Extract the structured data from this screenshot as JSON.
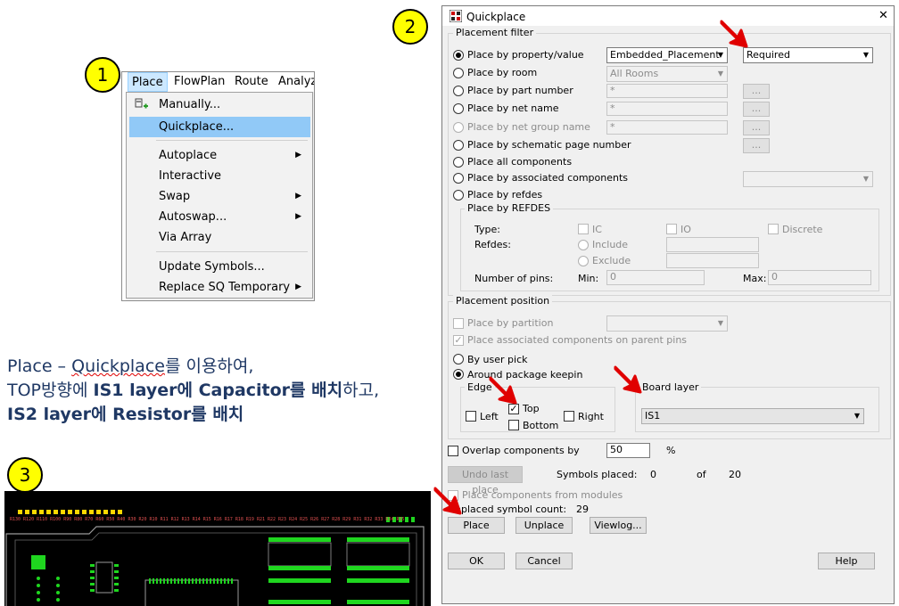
{
  "badges": [
    "1",
    "2",
    "3"
  ],
  "menu": {
    "menubar": [
      "Place",
      "FlowPlan",
      "Route",
      "Analyze"
    ],
    "items": [
      {
        "label": "Manually...",
        "arrow": false
      },
      {
        "label": "Quickplace...",
        "arrow": false
      },
      {
        "label": "Autoplace",
        "arrow": true
      },
      {
        "label": "Interactive",
        "arrow": false
      },
      {
        "label": "Swap",
        "arrow": true
      },
      {
        "label": "Autoswap...",
        "arrow": true
      },
      {
        "label": "Via Array",
        "arrow": false
      },
      {
        "label": "Update Symbols...",
        "arrow": false
      },
      {
        "label": "Replace SQ Temporary",
        "arrow": true
      }
    ],
    "arrow_glyph": "▶"
  },
  "instruction": {
    "line1_a": "Place  – ",
    "line1_b": "Quickplace",
    "line1_c": "를  이용하여,",
    "line2_a": "TOP방향에 ",
    "line2_b": "IS1 layer에 Capacitor를 배치",
    "line2_c": "하고,",
    "line3": "IS2 layer에 Resistor를  배치"
  },
  "dialog": {
    "title": "Quickplace",
    "close": "✕",
    "filter_group": "Placement filter",
    "filter_options": [
      "Place by property/value",
      "Place by room",
      "Place by part number",
      "Place by net name",
      "Place by net group name",
      "Place by schematic page number",
      "Place all components",
      "Place by associated components",
      "Place by refdes"
    ],
    "property_combo": "Embedded_Placement",
    "value_combo": "Required",
    "room_combo": "All Rooms",
    "wildcard": "*",
    "browse": "...",
    "refdes_group": "Place by REFDES",
    "type_label": "Type:",
    "type_ic": "IC",
    "type_io": "IO",
    "type_discrete": "Discrete",
    "refdes_label": "Refdes:",
    "include": "Include",
    "exclude": "Exclude",
    "pins_label": "Number of pins:",
    "min_label": "Min:",
    "min_val": "0",
    "max_label": "Max:",
    "max_val": "0",
    "position_group": "Placement position",
    "by_partition": "Place by partition",
    "assoc_parent": "Place associated components on parent pins",
    "by_user_pick": "By user pick",
    "around_keepin": "Around package keepin",
    "edge_group": "Edge",
    "edge_left": "Left",
    "edge_top": "Top",
    "edge_bottom": "Bottom",
    "edge_right": "Right",
    "board_layer_group": "Board layer",
    "board_layer": "IS1",
    "overlap": "Overlap components by",
    "overlap_val": "50",
    "percent": "%",
    "undo": "Undo last place",
    "symbols_placed": "Symbols placed:",
    "placed_val": "0",
    "of": "of",
    "total_val": "20",
    "from_modules": "Place components from modules",
    "unplaced": "Unplaced symbol count:",
    "unplaced_val": "29",
    "place": "Place",
    "unplace": "Unplace",
    "viewlog": "Viewlog...",
    "ok": "OK",
    "cancel": "Cancel",
    "help": "Help",
    "check": "✓"
  },
  "colors": {
    "badge": "#ffff00",
    "arrow": "#e00000",
    "highlight": "#91c9f7",
    "instruction_text": "#1f3864",
    "pcb_bg": "#000000",
    "pcb_pad": "#1fd61f",
    "pcb_yellow": "#ffd800",
    "pcb_outline": "#9a9a9a"
  }
}
